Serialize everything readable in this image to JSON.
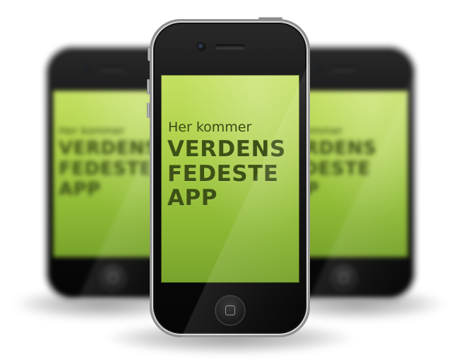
{
  "app_screen": {
    "kicker": "Her kommer",
    "headline_lines": [
      "VERDENS",
      "FEDESTE",
      "APP"
    ]
  },
  "colors": {
    "screen_green": "#aed14a",
    "headline_text": "#3d5116",
    "phone_body": "#0d0d0d"
  },
  "icons": {
    "home_button": "home-button-icon",
    "camera": "front-camera-icon",
    "speaker": "earpiece-speaker-icon"
  }
}
